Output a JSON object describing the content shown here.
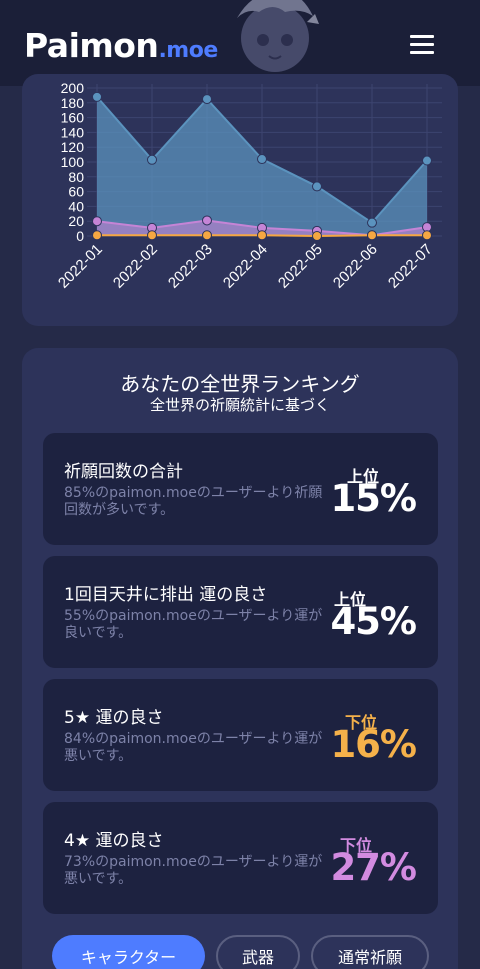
{
  "header": {
    "logo_main": "Paimon",
    "logo_suffix": ".moe",
    "menu_icon": "hamburger-menu-icon"
  },
  "chart_data": {
    "type": "area",
    "categories": [
      "2022-01",
      "2022-02",
      "2022-03",
      "2022-04",
      "2022-05",
      "2022-06",
      "2022-07"
    ],
    "series": [
      {
        "values": [
          188,
          103,
          185,
          104,
          67,
          18,
          102
        ],
        "color": "#5b93be"
      },
      {
        "values": [
          20,
          11,
          21,
          11,
          7,
          1,
          12
        ],
        "color": "#c584d6"
      },
      {
        "values": [
          1,
          1,
          1,
          1,
          0,
          1,
          1
        ],
        "color": "#f5a742"
      }
    ],
    "y_ticks": [
      "0",
      "20",
      "40",
      "60",
      "80",
      "100",
      "120",
      "140",
      "160",
      "180",
      "200"
    ],
    "ylim": [
      0,
      200
    ],
    "grid": true
  },
  "ranking": {
    "title": "あなたの全世界ランキング",
    "subtitle": "全世界の祈願統計に基づく",
    "items": [
      {
        "label": "祈願回数の合計",
        "desc": "85%のpaimon.moeのユーザーより祈願回数が多いです。",
        "tier": "上位",
        "percent": "15%",
        "color": "#ffffff"
      },
      {
        "label": "1回目天井に排出 運の良さ",
        "desc": "55%のpaimon.moeのユーザーより運が良いです。",
        "tier": "上位",
        "percent": "45%",
        "color": "#ffffff"
      },
      {
        "label": "5★ 運の良さ",
        "desc": "84%のpaimon.moeのユーザーより運が悪いです。",
        "tier": "下位",
        "percent": "16%",
        "color": "#f5b14a"
      },
      {
        "label": "4★ 運の良さ",
        "desc": "73%のpaimon.moeのユーザーより運が悪いです。",
        "tier": "下位",
        "percent": "27%",
        "color": "#d28be0"
      }
    ]
  },
  "tabs": [
    {
      "label": "キャラクター",
      "active": true
    },
    {
      "label": "武器",
      "active": false
    },
    {
      "label": "通常祈願",
      "active": false
    }
  ]
}
